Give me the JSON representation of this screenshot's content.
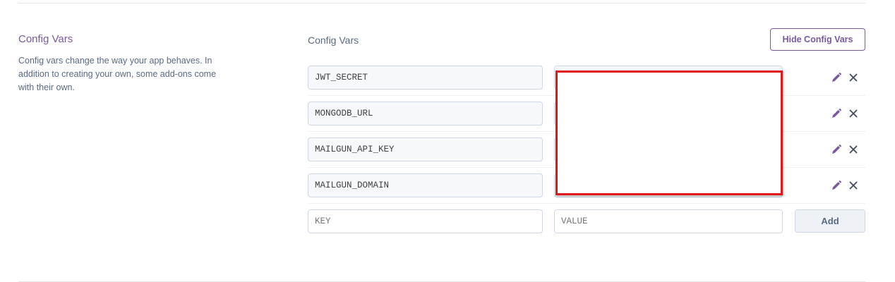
{
  "section": {
    "title": "Config Vars",
    "description": "Config vars change the way your app behaves. In addition to creating your own, some add-ons come with their own."
  },
  "config": {
    "header": "Config Vars",
    "hide_button_label": "Hide Config Vars",
    "vars": [
      {
        "key": "JWT_SECRET",
        "value": ""
      },
      {
        "key": "MONGODB_URL",
        "value": ""
      },
      {
        "key": "MAILGUN_API_KEY",
        "value": ""
      },
      {
        "key": "MAILGUN_DOMAIN",
        "value": ""
      }
    ],
    "new_row": {
      "key_placeholder": "KEY",
      "value_placeholder": "VALUE",
      "add_button_label": "Add"
    }
  },
  "icons": {
    "edit": "pencil-icon",
    "delete": "close-icon"
  },
  "colors": {
    "accent": "#79589f",
    "text_muted": "#596981",
    "redaction": "#e0161b"
  }
}
